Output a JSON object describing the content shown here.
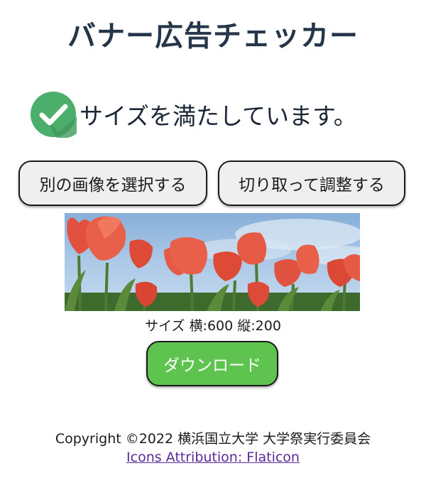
{
  "header": {
    "title": "バナー広告チェッカー"
  },
  "status": {
    "icon": "check-circle-icon",
    "message": "サイズを満たしています。",
    "icon_color": "#4cae6b"
  },
  "buttons": {
    "select_image": "別の画像を選択する",
    "crop_adjust": "切り取って調整する",
    "download": "ダウンロード"
  },
  "preview": {
    "image_description_icon": "tulip-banner-image",
    "size_label": "サイズ 横:600 縦:200"
  },
  "footer": {
    "copyright": "Copyright ©2022 横浜国立大学 大学祭実行委員会",
    "attribution_link": "Icons Attribution: Flaticon"
  },
  "colors": {
    "title": "#25364a",
    "download_bg": "#5fc44f",
    "button_bg": "#efefef",
    "link": "#5a2a9a"
  }
}
